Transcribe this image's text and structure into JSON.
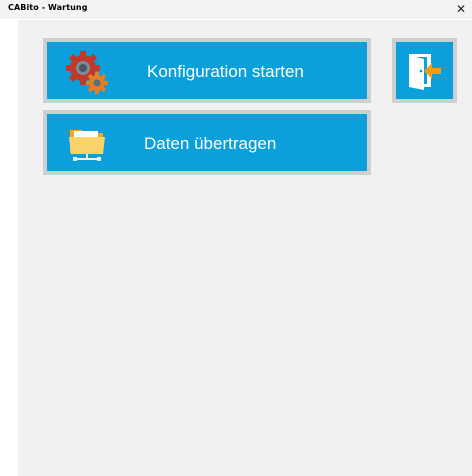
{
  "window": {
    "title": "CABito - Wartung",
    "close_label": "✕"
  },
  "buttons": {
    "config_label": "Konfiguration starten",
    "data_label": "Daten übertragen"
  },
  "icons": {
    "config": "gears-icon",
    "data": "network-folder-icon",
    "exit": "exit-door-icon"
  },
  "colors": {
    "button_bg": "#0b9fdc",
    "button_border": "#cfcfcf",
    "client_bg": "#f1f1f1",
    "accent_orange": "#f39c12"
  }
}
